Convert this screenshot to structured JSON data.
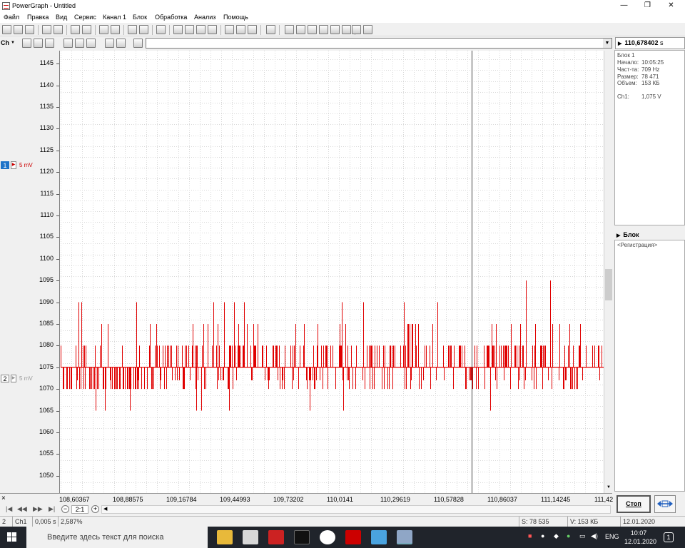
{
  "window": {
    "title": "PowerGraph - Untitled",
    "minimize": "—",
    "maximize": "❐",
    "close": "✕"
  },
  "menu": [
    "Файл",
    "Правка",
    "Вид",
    "Сервис",
    "Канал 1",
    "Блок",
    "Обработка",
    "Анализ",
    "Помощь"
  ],
  "toolbar2": {
    "channel": "Ch",
    "dropdown": "▼",
    "combo_value": ""
  },
  "time_display": {
    "value": "110,678402",
    "unit": "s"
  },
  "channels": [
    {
      "number": "1",
      "scale": "5 mV",
      "active": true,
      "color": "#cc0000"
    },
    {
      "number": "2",
      "scale": "5 mV",
      "active": false,
      "color": "#a0a0a0"
    }
  ],
  "info": {
    "block": "Блок 1",
    "rows": [
      {
        "label": "Начало:",
        "value": "10:05:25"
      },
      {
        "label": "Част-та:",
        "value": "709 Hz"
      },
      {
        "label": "Размер:",
        "value": "78 471"
      },
      {
        "label": "Объем:",
        "value": "153 КБ"
      }
    ],
    "channel_reading": {
      "label": "Ch1:",
      "value": "1,075 V"
    }
  },
  "block_panel": {
    "header": "Блок",
    "items": [
      "<Регистрация>"
    ]
  },
  "chart_data": {
    "type": "line",
    "series": [
      {
        "values": "noisy step signal around 1075 with spikes up to 1095 and down to 1065"
      }
    ],
    "y_ticks": [
      "1145",
      "1140",
      "1135",
      "1130",
      "1125",
      "1120",
      "1115",
      "1110",
      "1105",
      "1100",
      "1095",
      "1090",
      "1085",
      "1080",
      "1075",
      "1070",
      "1065",
      "1060",
      "1055",
      "1050"
    ],
    "x_ticks": [
      "108,60367",
      "108,88575",
      "109,16784",
      "109,44993",
      "109,73202",
      "110,0141",
      "110,29619",
      "110,57828",
      "110,86037",
      "111,14245",
      "111,42"
    ],
    "ylim": [
      1046,
      1148
    ],
    "baseline": 1075,
    "cursor_x": "110,678402",
    "grid": true,
    "color": "#e00000"
  },
  "xaxis": {
    "close": "×"
  },
  "hscroll": {
    "first": "|◀",
    "prev": "◀◀",
    "next": "▶▶",
    "last": "▶|",
    "minus": "−",
    "plus": "+",
    "ratio": "2:1",
    "left": "◀",
    "right": "▶"
  },
  "status": [
    "2",
    "Ch1",
    "0,005 s",
    "2,587%",
    "",
    "S: 78 535",
    "V: 153 КБ",
    "12.01.2020"
  ],
  "buttons": {
    "stop": "Стоп"
  },
  "taskbar": {
    "search_placeholder": "Введите здесь текст для поиска",
    "lang": "ENG",
    "time": "10:07",
    "date": "12.01.2020",
    "notifications": "1"
  }
}
